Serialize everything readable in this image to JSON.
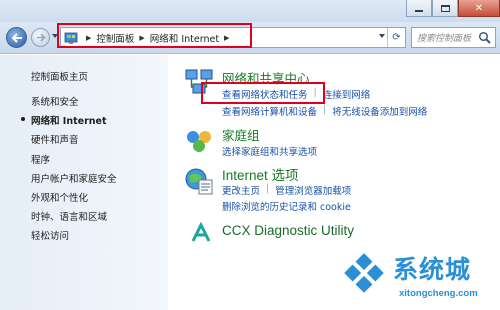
{
  "nav": {
    "breadcrumbs": [
      "控制面板",
      "网络和 Internet"
    ],
    "search_placeholder": "搜索控制面板"
  },
  "sidebar": {
    "home_label": "控制面板主页",
    "items": [
      {
        "label": "系统和安全",
        "active": false
      },
      {
        "label": "网络和 Internet",
        "active": true
      },
      {
        "label": "硬件和声音",
        "active": false
      },
      {
        "label": "程序",
        "active": false
      },
      {
        "label": "用户帐户和家庭安全",
        "active": false
      },
      {
        "label": "外观和个性化",
        "active": false
      },
      {
        "label": "时钟、语言和区域",
        "active": false
      },
      {
        "label": "轻松访问",
        "active": false
      }
    ]
  },
  "categories": [
    {
      "title": "网络和共享中心",
      "icon": "network-sharing-center-icon",
      "links": [
        "查看网络状态和任务",
        "连接到网络",
        "查看网络计算机和设备",
        "将无线设备添加到网络"
      ]
    },
    {
      "title": "家庭组",
      "icon": "homegroup-icon",
      "links": [
        "选择家庭组和共享选项"
      ]
    },
    {
      "title": "Internet 选项",
      "icon": "internet-options-icon",
      "links": [
        "更改主页",
        "管理浏览器加载项",
        "删除浏览的历史记录和 cookie"
      ]
    },
    {
      "title": "CCX Diagnostic Utility",
      "icon": "ccx-diagnostic-icon",
      "links": []
    }
  ],
  "watermark": {
    "text": "系统城",
    "url": "xitongcheng.com"
  },
  "colors": {
    "link": "#1850a8",
    "category_title": "#1a7a25",
    "highlight_box": "#e0001b",
    "watermark": "#2b8fd8"
  }
}
